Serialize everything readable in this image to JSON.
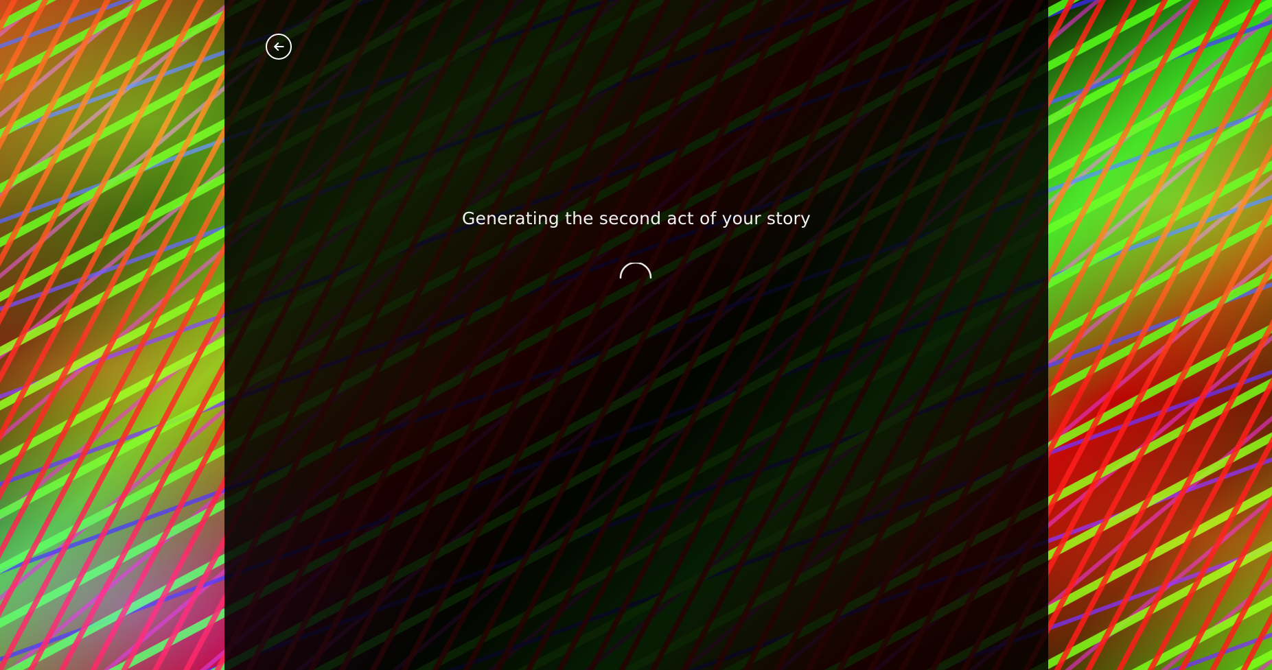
{
  "loading": {
    "message": "Generating the second act of your story"
  },
  "controls": {
    "back_icon": "arrow-left-circle-icon",
    "spinner_icon": "loading-spinner-icon"
  },
  "colors": {
    "panel_overlay": "#000000",
    "text": "#f2f2f2",
    "icon": "#ffffff"
  }
}
